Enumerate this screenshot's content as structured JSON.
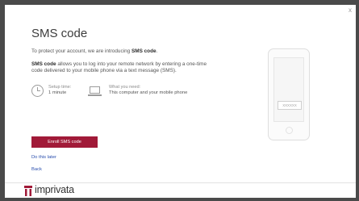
{
  "dialog": {
    "close_label": "x",
    "title": "SMS code",
    "intro_prefix": "To protect your account, we are introducing ",
    "intro_bold": "SMS code",
    "intro_suffix": ".",
    "desc_bold": "SMS code",
    "desc_text": " allows you to log into your remote network by entering a one-time code delivered to your mobile phone via a text message (SMS).",
    "setup_label": "Setup time:",
    "setup_value": "1 minute",
    "need_label": "What you need:",
    "need_value": "This computer and your mobile phone",
    "enroll_button": "Enroll SMS code",
    "do_later_link": "Do this later",
    "back_link": "Back"
  },
  "phone_illustration": {
    "code_placeholder": "XXXXXX"
  },
  "footer": {
    "brand_name": "imprivata",
    "brand_color": "#a11a38"
  },
  "colors": {
    "accent": "#a11a38",
    "link": "#2a4fae",
    "backdrop": "#4a4a4a"
  },
  "icons": [
    "clock-icon",
    "laptop-icon",
    "close-icon",
    "imprivata-logo-icon"
  ]
}
